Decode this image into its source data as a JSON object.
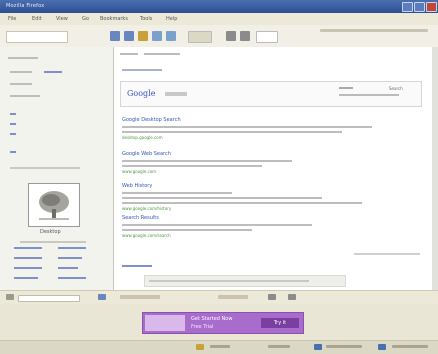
{
  "window": {
    "title": "Mozilla Firefox"
  },
  "menu": [
    "File",
    "Edit",
    "View",
    "Go",
    "Bookmarks",
    "Tools",
    "Help"
  ],
  "search": {
    "logo": "Google",
    "button": "Search"
  },
  "results": [
    {
      "title": "Google Desktop Search",
      "url": "desktop.google.com"
    },
    {
      "title": "Google Web Search",
      "url": "www.google.com"
    },
    {
      "title": "Web History",
      "url": "www.google.com/history"
    },
    {
      "title": "Search Results",
      "url": "www.google.com/search"
    }
  ],
  "sidebar": {
    "caption": "Desktop"
  },
  "ad": {
    "line1": "Get Started Now",
    "line2": "Free Trial",
    "button": "Try it"
  },
  "colors": {
    "title": "#2c4f90",
    "chrome": "#ece9d8",
    "link": "#3355bb",
    "ad": "#a86ccc"
  }
}
